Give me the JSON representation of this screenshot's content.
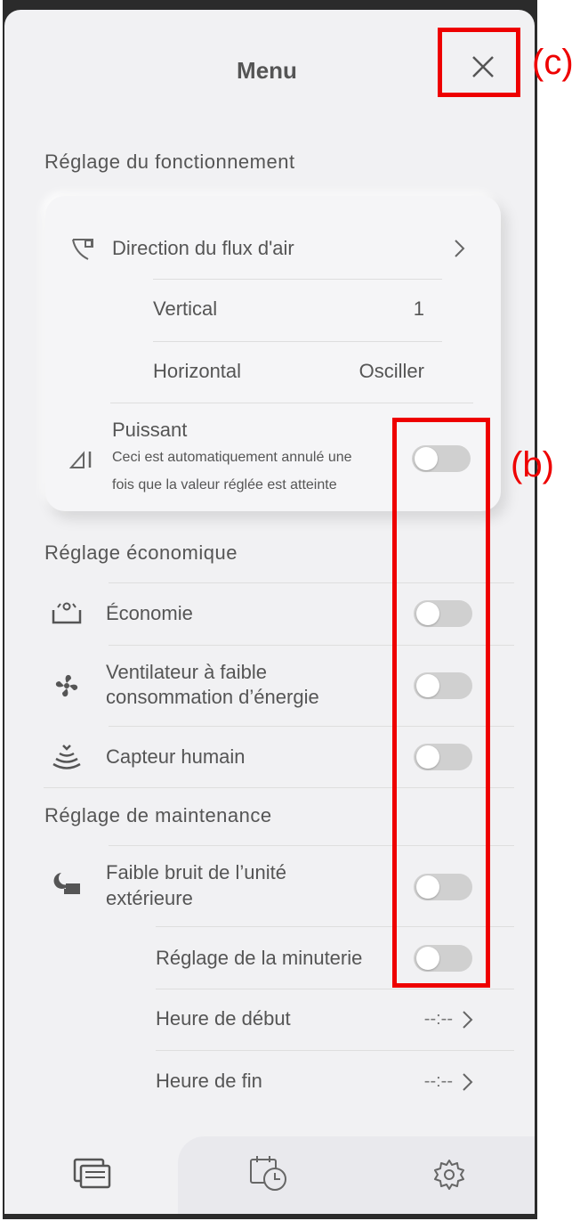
{
  "header": {
    "title": "Menu"
  },
  "sections": {
    "operation": {
      "title": "Réglage du fonctionnement",
      "airflow": {
        "label": "Direction du flux d'air"
      },
      "vertical": {
        "label": "Vertical",
        "value": "1"
      },
      "horizontal": {
        "label": "Horizontal",
        "value": "Osciller"
      },
      "powerful": {
        "label": "Puissant",
        "desc_line1": "Ceci est automatiquement annulé une",
        "desc_line2": "fois que la valeur réglée est atteinte",
        "enabled": false
      }
    },
    "economy": {
      "title": "Réglage économique",
      "items": [
        {
          "label": "Économie",
          "icon": "economy-icon",
          "enabled": false
        },
        {
          "label_line1": "Ventilateur à faible",
          "label_line2": "consommation d’énergie",
          "icon": "fan-icon",
          "enabled": false
        },
        {
          "label": "Capteur humain",
          "icon": "human-sensor-icon",
          "enabled": false
        }
      ]
    },
    "maintenance": {
      "title": "Réglage de maintenance",
      "quiet": {
        "label_line1": "Faible bruit de l’unité",
        "label_line2": "extérieure",
        "icon": "outdoor-quiet-icon",
        "enabled": false
      },
      "timer": {
        "label": "Réglage de la minuterie",
        "enabled": false
      },
      "start": {
        "label": "Heure de début",
        "value": "--:--"
      },
      "end": {
        "label": "Heure de fin",
        "value": "--:--"
      }
    }
  },
  "annotations": {
    "b": "(b)",
    "c": "(c)"
  },
  "bottom_tabs": [
    "menu-icon",
    "schedule-icon",
    "settings-icon"
  ],
  "colors": {
    "annotation": "#ee0000",
    "toggle_off": "#d0d0d0",
    "panel": "#f1f1f3"
  }
}
